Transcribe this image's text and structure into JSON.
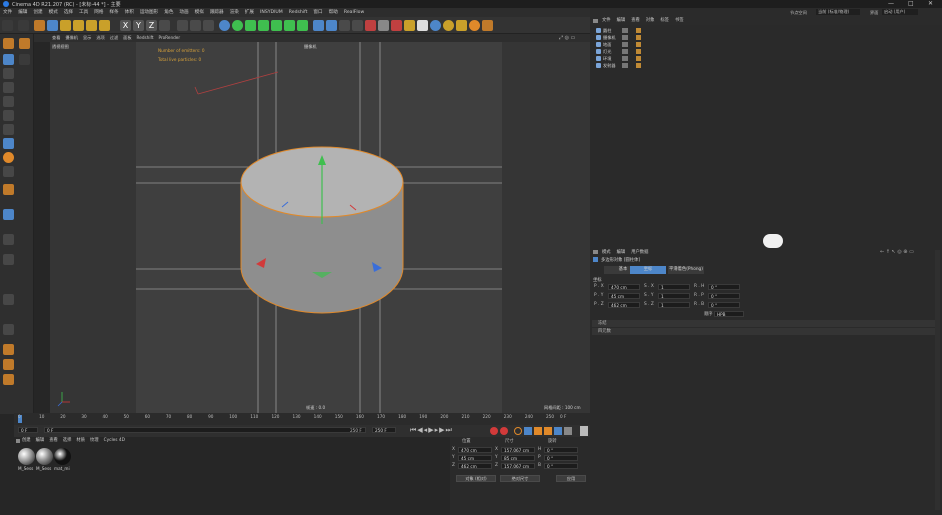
{
  "window": {
    "title": "Cinema 4D R21.207 (RC) - [未标-44 *] - 主要",
    "controls": [
      "—",
      "□",
      "✕"
    ]
  },
  "menubar": {
    "items": [
      "文件",
      "编辑",
      "创建",
      "模式",
      "选择",
      "工具",
      "网格",
      "样条",
      "体积",
      "运动图形",
      "角色",
      "动画",
      "模拟",
      "跟踪器",
      "渲染",
      "扩展",
      "INSYDIUM",
      "Redshift",
      "窗口",
      "帮助",
      "RealFlow"
    ]
  },
  "om_tabs": {
    "label1": "节点空间",
    "value1": "当前 (标准/物理)",
    "label2": "界面",
    "value2": "启动 (用户)"
  },
  "viewport": {
    "header_menus": [
      "查看",
      "摄像机",
      "显示",
      "选项",
      "过滤",
      "面板",
      "Redshift",
      "ProRender"
    ],
    "label": "透视视图",
    "camera_label": "摄像机",
    "hud_line1": "Number of emitters: 0",
    "hud_line2": "Total live particles: 0",
    "grid_label": "网格间距 : 100 cm",
    "fps_label": "帧速 : 0.0"
  },
  "object_manager": {
    "menus": [
      "文件",
      "编辑",
      "查看",
      "对象",
      "标签",
      "书签"
    ],
    "objects": [
      {
        "name": "圆柱",
        "selected": false
      },
      {
        "name": "摄像机",
        "selected": false
      },
      {
        "name": "地面",
        "selected": false
      },
      {
        "name": "灯光",
        "selected": false
      },
      {
        "name": "环境",
        "selected": false
      },
      {
        "name": "发射器",
        "selected": false
      }
    ]
  },
  "attribute_manager": {
    "menus": [
      "模式",
      "编辑",
      "用户数据"
    ],
    "title": "多边形对象 [圆柱体]",
    "tabs": [
      "基本",
      "坐标",
      "平滑着色(Phong)"
    ],
    "active_tab": "坐标",
    "section_label": "坐标",
    "rows": [
      {
        "p_label": "P . X",
        "p_value": "470 cm",
        "s_label": "S . X",
        "s_value": "1",
        "r_label": "R . H",
        "r_value": "0 °"
      },
      {
        "p_label": "P . Y",
        "p_value": "45 cm",
        "s_label": "S . Y",
        "s_value": "1",
        "r_label": "R . P",
        "r_value": "0 °"
      },
      {
        "p_label": "P . Z",
        "p_value": "462 cm",
        "s_label": "S . Z",
        "s_value": "1",
        "r_label": "R . B",
        "r_value": "0 °"
      }
    ],
    "order_label": "顺序",
    "order_value": "HPB",
    "collapsed_sections": [
      "冻结",
      "四元数"
    ]
  },
  "timeline": {
    "ticks": [
      "0",
      "10",
      "20",
      "30",
      "40",
      "50",
      "60",
      "70",
      "80",
      "90",
      "100",
      "110",
      "120",
      "130",
      "140",
      "150",
      "160",
      "170",
      "180",
      "190",
      "200",
      "210",
      "220",
      "230",
      "240",
      "250"
    ],
    "end_label": "0 F",
    "current_frame": "0 F",
    "start_field": "0 F",
    "end_field": "250 F",
    "end_field2": "250 F"
  },
  "material_manager": {
    "menus": [
      "创建",
      "编辑",
      "查看",
      "选择",
      "材质",
      "纹理",
      "Cycles 4D"
    ],
    "materials": [
      {
        "label": "M_Sess",
        "color": "#9a9a9a"
      },
      {
        "label": "M_Sess",
        "color": "#8a8a8a"
      },
      {
        "label": "mat_mi",
        "color": "#111111"
      }
    ]
  },
  "coordinates": {
    "headers": [
      "位置",
      "尺寸",
      "旋转"
    ],
    "rows": [
      {
        "axis": "X",
        "pos": "470 cm",
        "saxis": "X",
        "size": "157.067 cm",
        "raxis": "H",
        "rot": "0 °"
      },
      {
        "axis": "Y",
        "pos": "45 cm",
        "saxis": "Y",
        "size": "85 cm",
        "raxis": "P",
        "rot": "0 °"
      },
      {
        "axis": "Z",
        "pos": "462 cm",
        "saxis": "Z",
        "size": "157.067 cm",
        "raxis": "B",
        "rot": "0 °"
      }
    ],
    "mode_object": "对象 (相对)",
    "mode_size": "绝对尺寸",
    "apply": "应用"
  },
  "colors": {
    "accent_blue": "#4d86c9",
    "selection_orange": "#e0892a",
    "axis_red": "#d23a3a",
    "axis_green": "#3fbf4f",
    "axis_blue": "#3a6ed9"
  }
}
